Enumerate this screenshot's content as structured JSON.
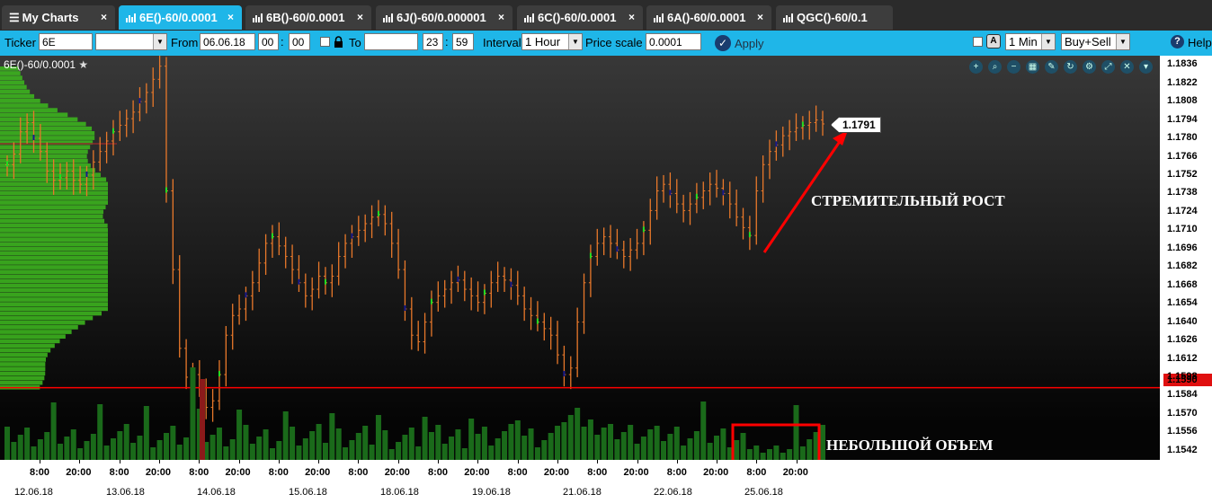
{
  "tabs": [
    {
      "label": "My Charts",
      "active": false
    },
    {
      "label": "6E()-60/0.0001",
      "active": true
    },
    {
      "label": "6B()-60/0.0001",
      "active": false
    },
    {
      "label": "6J()-60/0.000001",
      "active": false
    },
    {
      "label": "6C()-60/0.0001",
      "active": false
    },
    {
      "label": "6A()-60/0.0001",
      "active": false
    },
    {
      "label": "QGC()-60/0.1",
      "active": false
    }
  ],
  "toolbar": {
    "ticker_label": "Ticker",
    "ticker_value": "6E",
    "ticker_select": "",
    "from_label": "From",
    "from_date": "06.06.18",
    "from_hour": "00",
    "from_min": "00",
    "to_label": "To",
    "to_date": "",
    "to_hour": "23",
    "to_min": "59",
    "interval_label": "Interval",
    "interval_value": "1 Hour",
    "price_scale_label": "Price scale",
    "price_scale_value": "0.0001",
    "apply_label": "Apply",
    "tf_value": "1 Min",
    "side_value": "Buy+Sell",
    "help_label": "Help"
  },
  "chart": {
    "title": "6E()-60/0.0001",
    "price_ticks": [
      "1.1836",
      "1.1822",
      "1.1808",
      "1.1794",
      "1.1780",
      "1.1766",
      "1.1752",
      "1.1738",
      "1.1724",
      "1.1710",
      "1.1696",
      "1.1682",
      "1.1668",
      "1.1654",
      "1.1640",
      "1.1626",
      "1.1612",
      "1.1598",
      "1.1584",
      "1.1570",
      "1.1556",
      "1.1542"
    ],
    "current_price": "1.1791",
    "line_price": "1.1590",
    "time_ticks": [
      "8:00",
      "20:00",
      "8:00",
      "20:00",
      "8:00",
      "20:00",
      "8:00",
      "20:00",
      "8:00",
      "20:00",
      "8:00",
      "20:00",
      "8:00",
      "20:00",
      "8:00",
      "20:00",
      "8:00",
      "20:00",
      "8:00",
      "20:00"
    ],
    "dates": [
      "12.06.18",
      "13.06.18",
      "14.06.18",
      "15.06.18",
      "18.06.18",
      "19.06.18",
      "21.06.18",
      "22.06.18",
      "25.06.18"
    ],
    "annotation_rise": "СТРЕМИТЕЛЬНЫЙ РОСТ",
    "annotation_volume": "НЕБОЛЬШОЙ ОБЪЕМ",
    "colors": {
      "bar": "#e8782a",
      "up": "#22dd22",
      "down": "#1a1a8c",
      "accent": "#1fb6e8",
      "line": "#ff0000",
      "volume": "#1a6a1a",
      "profile": "#3cb31e"
    },
    "chart_data": {
      "type": "line",
      "ylim": [
        1.1535,
        1.1843
      ],
      "closes": [
        1.176,
        1.1768,
        1.1785,
        1.1792,
        1.178,
        1.177,
        1.1755,
        1.1748,
        1.175,
        1.1755,
        1.1748,
        1.1745,
        1.1752,
        1.1762,
        1.177,
        1.1778,
        1.1785,
        1.179,
        1.1795,
        1.18,
        1.1808,
        1.1815,
        1.1825,
        1.1835,
        1.174,
        1.168,
        1.162,
        1.1598,
        1.16,
        1.159,
        1.1575,
        1.158,
        1.16,
        1.163,
        1.1645,
        1.165,
        1.166,
        1.167,
        1.1685,
        1.17,
        1.1705,
        1.1698,
        1.169,
        1.168,
        1.167,
        1.166,
        1.1665,
        1.1675,
        1.167,
        1.1675,
        1.169,
        1.17,
        1.1705,
        1.171,
        1.1715,
        1.172,
        1.1722,
        1.1715,
        1.17,
        1.168,
        1.165,
        1.163,
        1.1625,
        1.164,
        1.1655,
        1.166,
        1.1665,
        1.167,
        1.1672,
        1.1665,
        1.166,
        1.1655,
        1.1662,
        1.167,
        1.1675,
        1.1672,
        1.1668,
        1.166,
        1.165,
        1.1645,
        1.164,
        1.1635,
        1.163,
        1.1615,
        1.16,
        1.1605,
        1.164,
        1.167,
        1.169,
        1.17,
        1.1705,
        1.17,
        1.1695,
        1.169,
        1.1695,
        1.17,
        1.171,
        1.1725,
        1.174,
        1.1745,
        1.1738,
        1.173,
        1.1725,
        1.173,
        1.1735,
        1.174,
        1.1745,
        1.1742,
        1.1738,
        1.173,
        1.172,
        1.1712,
        1.1706,
        1.174,
        1.176,
        1.177,
        1.1775,
        1.1782,
        1.1785,
        1.1788,
        1.179,
        1.1792,
        1.1794,
        1.1791
      ]
    }
  }
}
